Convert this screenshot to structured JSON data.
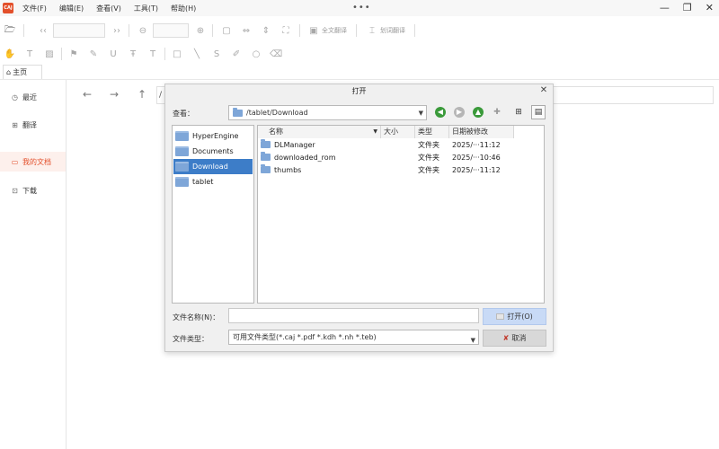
{
  "app": {
    "logo": "CAJ",
    "menu": [
      "文件(F)",
      "编辑(E)",
      "查看(V)",
      "工具(T)",
      "帮助(H)"
    ],
    "overflow": "•••"
  },
  "toolbar": {
    "full_translate": "全文翻译",
    "word_translate": "划词翻译"
  },
  "tab": {
    "home": "主页"
  },
  "sidebar": {
    "items": [
      {
        "label": "最近",
        "icon": "clock-icon"
      },
      {
        "label": "翻译",
        "icon": "translate-icon"
      },
      {
        "label": "我的文档",
        "icon": "folder-icon",
        "active": true
      },
      {
        "label": "下载",
        "icon": "download-icon"
      }
    ]
  },
  "main": {
    "path_prefix": "/"
  },
  "dialog": {
    "title": "打开",
    "look_in_label": "查看：",
    "look_in_value": "/tablet/Download",
    "places": [
      {
        "label": "HyperEngine"
      },
      {
        "label": "Documents"
      },
      {
        "label": "Download",
        "selected": true
      },
      {
        "label": "tablet"
      }
    ],
    "columns": [
      "名称",
      "大小",
      "类型",
      "日期被修改"
    ],
    "files": [
      {
        "name": "DLManager",
        "size": "",
        "type": "文件夹",
        "date": "2025/···11:12"
      },
      {
        "name": "downloaded_rom",
        "size": "",
        "type": "文件夹",
        "date": "2025/···10:46"
      },
      {
        "name": "thumbs",
        "size": "",
        "type": "文件夹",
        "date": "2025/···11:12"
      }
    ],
    "file_name_label": "文件名称(N)：",
    "file_name_value": "",
    "file_type_label": "文件类型：",
    "file_type_value": "可用文件类型(*.caj *.pdf *.kdh *.nh *.teb)",
    "open_button": "打开(O)",
    "cancel_button": "取消"
  },
  "colors": {
    "brand": "#e3502b",
    "selection": "#3d7dc8",
    "open_button": "#c8daf6"
  }
}
